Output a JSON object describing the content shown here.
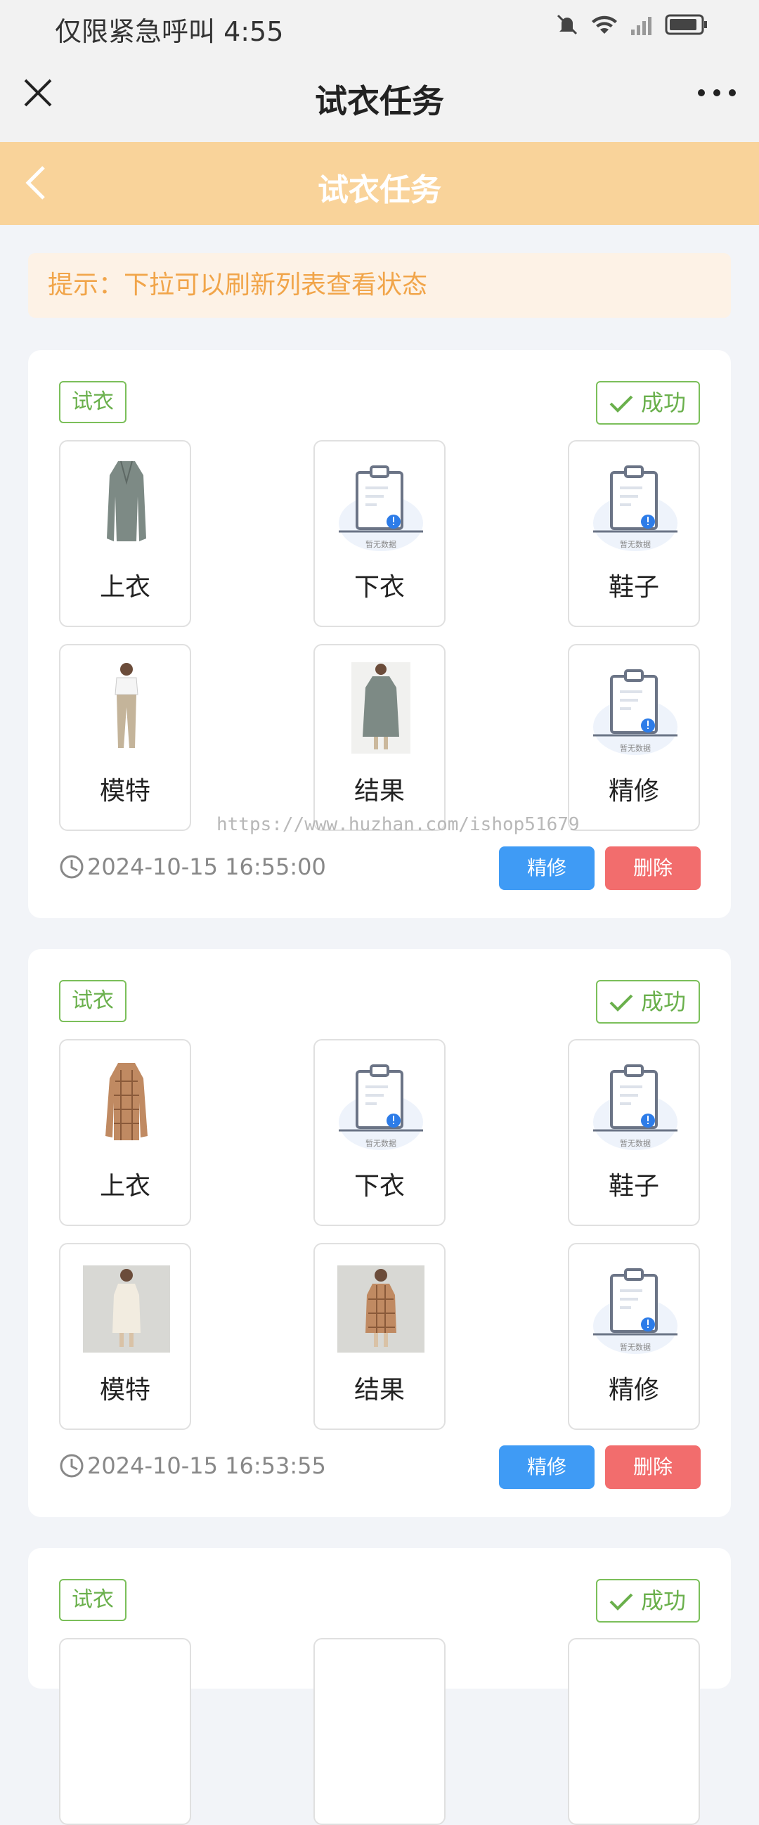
{
  "status_bar": {
    "left_text": "仅限紧急呼叫 4:55"
  },
  "title_bar": {
    "title": "试衣任务"
  },
  "header": {
    "title": "试衣任务"
  },
  "tip": {
    "text": "提示：下拉可以刷新列表查看状态"
  },
  "watermark": "https://www.huzhan.com/ishop51679",
  "empty_label": "暂无数据",
  "cards": [
    {
      "tag": "试衣",
      "status": "成功",
      "tiles": [
        {
          "label": "上衣",
          "image": "garment-coat"
        },
        {
          "label": "下衣",
          "image": "empty-state"
        },
        {
          "label": "鞋子",
          "image": "empty-state"
        },
        {
          "label": "模特",
          "image": "model-photo"
        },
        {
          "label": "结果",
          "image": "result-photo"
        },
        {
          "label": "精修",
          "image": "empty-state"
        }
      ],
      "time": "2024-10-15 16:55:00",
      "refine_label": "精修",
      "delete_label": "删除"
    },
    {
      "tag": "试衣",
      "status": "成功",
      "tiles": [
        {
          "label": "上衣",
          "image": "garment-plaid-dress"
        },
        {
          "label": "下衣",
          "image": "empty-state"
        },
        {
          "label": "鞋子",
          "image": "empty-state"
        },
        {
          "label": "模特",
          "image": "model-photo"
        },
        {
          "label": "结果",
          "image": "result-photo"
        },
        {
          "label": "精修",
          "image": "empty-state"
        }
      ],
      "time": "2024-10-15 16:53:55",
      "refine_label": "精修",
      "delete_label": "删除"
    },
    {
      "tag": "试衣",
      "status": "成功"
    }
  ],
  "colors": {
    "header_bg": "#f9d39a",
    "tip_text": "#f1a54a",
    "success_green": "#6ab04c",
    "refine_blue": "#3f9bf5",
    "delete_red": "#f26d6d"
  }
}
